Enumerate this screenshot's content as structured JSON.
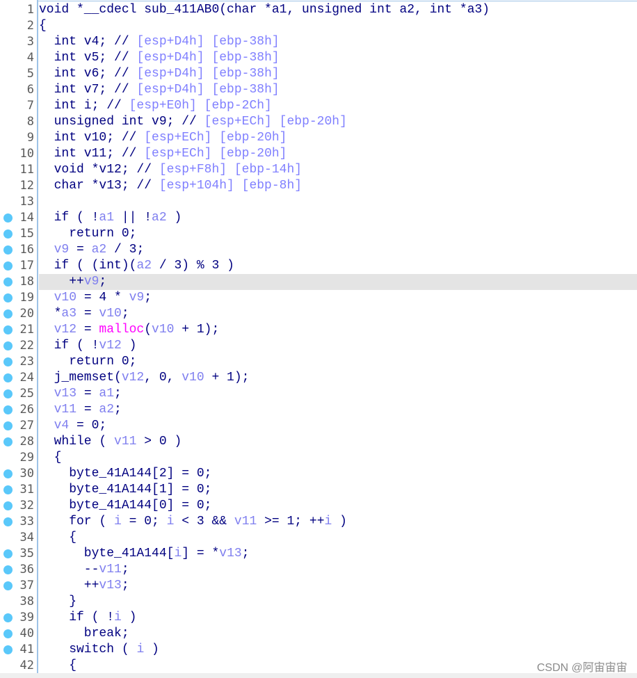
{
  "colors": {
    "keyword": "#000080",
    "variable": "#7f7fef",
    "comment": "#8080ff",
    "function": "#ff00ff",
    "breakpoint_dot": "#5ac8fa",
    "highlight": "#e4e4e4"
  },
  "highlighted_line": 18,
  "lines": [
    {
      "n": "1",
      "dot": false,
      "t": [
        [
          "k",
          "void *__cdecl sub_411AB0(char *a1, unsigned int a2, int *a3)"
        ]
      ]
    },
    {
      "n": "2",
      "dot": false,
      "t": [
        [
          "k",
          "{"
        ]
      ]
    },
    {
      "n": "3",
      "dot": false,
      "t": [
        [
          "k",
          "  int v4; // "
        ],
        [
          "c",
          "[esp+D4h] [ebp-38h]"
        ]
      ]
    },
    {
      "n": "4",
      "dot": false,
      "t": [
        [
          "k",
          "  int v5; // "
        ],
        [
          "c",
          "[esp+D4h] [ebp-38h]"
        ]
      ]
    },
    {
      "n": "5",
      "dot": false,
      "t": [
        [
          "k",
          "  int v6; // "
        ],
        [
          "c",
          "[esp+D4h] [ebp-38h]"
        ]
      ]
    },
    {
      "n": "6",
      "dot": false,
      "t": [
        [
          "k",
          "  int v7; // "
        ],
        [
          "c",
          "[esp+D4h] [ebp-38h]"
        ]
      ]
    },
    {
      "n": "7",
      "dot": false,
      "t": [
        [
          "k",
          "  int i; // "
        ],
        [
          "c",
          "[esp+E0h] [ebp-2Ch]"
        ]
      ]
    },
    {
      "n": "8",
      "dot": false,
      "t": [
        [
          "k",
          "  unsigned int v9; // "
        ],
        [
          "c",
          "[esp+ECh] [ebp-20h]"
        ]
      ]
    },
    {
      "n": "9",
      "dot": false,
      "t": [
        [
          "k",
          "  int v10; // "
        ],
        [
          "c",
          "[esp+ECh] [ebp-20h]"
        ]
      ]
    },
    {
      "n": "10",
      "dot": false,
      "t": [
        [
          "k",
          "  int v11; // "
        ],
        [
          "c",
          "[esp+ECh] [ebp-20h]"
        ]
      ]
    },
    {
      "n": "11",
      "dot": false,
      "t": [
        [
          "k",
          "  void *v12; // "
        ],
        [
          "c",
          "[esp+F8h] [ebp-14h]"
        ]
      ]
    },
    {
      "n": "12",
      "dot": false,
      "t": [
        [
          "k",
          "  char *v13; // "
        ],
        [
          "c",
          "[esp+104h] [ebp-8h]"
        ]
      ]
    },
    {
      "n": "13",
      "dot": false,
      "t": []
    },
    {
      "n": "14",
      "dot": true,
      "t": [
        [
          "k",
          "  if ( !"
        ],
        [
          "v",
          "a1"
        ],
        [
          "k",
          " || !"
        ],
        [
          "v",
          "a2"
        ],
        [
          "k",
          " )"
        ]
      ]
    },
    {
      "n": "15",
      "dot": true,
      "t": [
        [
          "k",
          "    return 0;"
        ]
      ]
    },
    {
      "n": "16",
      "dot": true,
      "t": [
        [
          "k",
          "  "
        ],
        [
          "v",
          "v9"
        ],
        [
          "k",
          " = "
        ],
        [
          "v",
          "a2"
        ],
        [
          "k",
          " / 3;"
        ]
      ]
    },
    {
      "n": "17",
      "dot": true,
      "t": [
        [
          "k",
          "  if ( (int)("
        ],
        [
          "v",
          "a2"
        ],
        [
          "k",
          " / 3) % 3 )"
        ]
      ]
    },
    {
      "n": "18",
      "dot": true,
      "t": [
        [
          "k",
          "    ++"
        ],
        [
          "v",
          "v9"
        ],
        [
          "k",
          ";"
        ]
      ]
    },
    {
      "n": "19",
      "dot": true,
      "t": [
        [
          "k",
          "  "
        ],
        [
          "v",
          "v10"
        ],
        [
          "k",
          " = 4 * "
        ],
        [
          "v",
          "v9"
        ],
        [
          "k",
          ";"
        ]
      ]
    },
    {
      "n": "20",
      "dot": true,
      "t": [
        [
          "k",
          "  *"
        ],
        [
          "v",
          "a3"
        ],
        [
          "k",
          " = "
        ],
        [
          "v",
          "v10"
        ],
        [
          "k",
          ";"
        ]
      ]
    },
    {
      "n": "21",
      "dot": true,
      "t": [
        [
          "k",
          "  "
        ],
        [
          "v",
          "v12"
        ],
        [
          "k",
          " = "
        ],
        [
          "f",
          "malloc"
        ],
        [
          "k",
          "("
        ],
        [
          "v",
          "v10"
        ],
        [
          "k",
          " + 1);"
        ]
      ]
    },
    {
      "n": "22",
      "dot": true,
      "t": [
        [
          "k",
          "  if ( !"
        ],
        [
          "v",
          "v12"
        ],
        [
          "k",
          " )"
        ]
      ]
    },
    {
      "n": "23",
      "dot": true,
      "t": [
        [
          "k",
          "    return 0;"
        ]
      ]
    },
    {
      "n": "24",
      "dot": true,
      "t": [
        [
          "k",
          "  j_memset("
        ],
        [
          "v",
          "v12"
        ],
        [
          "k",
          ", 0, "
        ],
        [
          "v",
          "v10"
        ],
        [
          "k",
          " + 1);"
        ]
      ]
    },
    {
      "n": "25",
      "dot": true,
      "t": [
        [
          "k",
          "  "
        ],
        [
          "v",
          "v13"
        ],
        [
          "k",
          " = "
        ],
        [
          "v",
          "a1"
        ],
        [
          "k",
          ";"
        ]
      ]
    },
    {
      "n": "26",
      "dot": true,
      "t": [
        [
          "k",
          "  "
        ],
        [
          "v",
          "v11"
        ],
        [
          "k",
          " = "
        ],
        [
          "v",
          "a2"
        ],
        [
          "k",
          ";"
        ]
      ]
    },
    {
      "n": "27",
      "dot": true,
      "t": [
        [
          "k",
          "  "
        ],
        [
          "v",
          "v4"
        ],
        [
          "k",
          " = 0;"
        ]
      ]
    },
    {
      "n": "28",
      "dot": true,
      "t": [
        [
          "k",
          "  while ( "
        ],
        [
          "v",
          "v11"
        ],
        [
          "k",
          " > 0 )"
        ]
      ]
    },
    {
      "n": "29",
      "dot": false,
      "t": [
        [
          "k",
          "  {"
        ]
      ]
    },
    {
      "n": "30",
      "dot": true,
      "t": [
        [
          "k",
          "    byte_41A144[2] = 0;"
        ]
      ]
    },
    {
      "n": "31",
      "dot": true,
      "t": [
        [
          "k",
          "    byte_41A144[1] = 0;"
        ]
      ]
    },
    {
      "n": "32",
      "dot": true,
      "t": [
        [
          "k",
          "    byte_41A144[0] = 0;"
        ]
      ]
    },
    {
      "n": "33",
      "dot": true,
      "t": [
        [
          "k",
          "    for ( "
        ],
        [
          "v",
          "i"
        ],
        [
          "k",
          " = 0; "
        ],
        [
          "v",
          "i"
        ],
        [
          "k",
          " < 3 && "
        ],
        [
          "v",
          "v11"
        ],
        [
          "k",
          " >= 1; ++"
        ],
        [
          "v",
          "i"
        ],
        [
          "k",
          " )"
        ]
      ]
    },
    {
      "n": "34",
      "dot": false,
      "t": [
        [
          "k",
          "    {"
        ]
      ]
    },
    {
      "n": "35",
      "dot": true,
      "t": [
        [
          "k",
          "      byte_41A144["
        ],
        [
          "v",
          "i"
        ],
        [
          "k",
          "] = *"
        ],
        [
          "v",
          "v13"
        ],
        [
          "k",
          ";"
        ]
      ]
    },
    {
      "n": "36",
      "dot": true,
      "t": [
        [
          "k",
          "      --"
        ],
        [
          "v",
          "v11"
        ],
        [
          "k",
          ";"
        ]
      ]
    },
    {
      "n": "37",
      "dot": true,
      "t": [
        [
          "k",
          "      ++"
        ],
        [
          "v",
          "v13"
        ],
        [
          "k",
          ";"
        ]
      ]
    },
    {
      "n": "38",
      "dot": false,
      "t": [
        [
          "k",
          "    }"
        ]
      ]
    },
    {
      "n": "39",
      "dot": true,
      "t": [
        [
          "k",
          "    if ( !"
        ],
        [
          "v",
          "i"
        ],
        [
          "k",
          " )"
        ]
      ]
    },
    {
      "n": "40",
      "dot": true,
      "t": [
        [
          "k",
          "      break;"
        ]
      ]
    },
    {
      "n": "41",
      "dot": true,
      "t": [
        [
          "k",
          "    switch ( "
        ],
        [
          "v",
          "i"
        ],
        [
          "k",
          " )"
        ]
      ]
    },
    {
      "n": "42",
      "dot": false,
      "t": [
        [
          "k",
          "    {"
        ]
      ]
    }
  ],
  "watermark": "CSDN @阿宙宙宙"
}
